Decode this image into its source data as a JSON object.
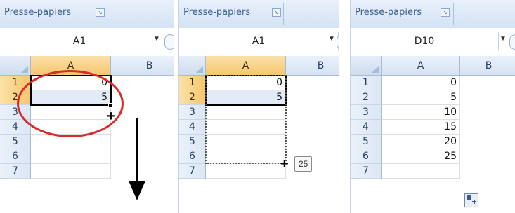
{
  "colors": {
    "accent_selected_header": "#f7c66e",
    "annotation_red": "#d92b2b"
  },
  "panels": [
    {
      "clipboard_label": "Presse-papiers",
      "namebox": "A1",
      "col_headers": [
        "A",
        "B"
      ],
      "row_headers": [
        "1",
        "2",
        "3",
        "4",
        "5",
        "6",
        "7"
      ],
      "cells": [
        "0",
        "5",
        "",
        "",
        "",
        "",
        ""
      ],
      "icons": [
        "dialog-launcher-icon",
        "chevron-down-icon",
        "fill-handle-crosshair-icon",
        "down-arrow-icon"
      ]
    },
    {
      "clipboard_label": "Presse-papiers",
      "namebox": "A1",
      "col_headers": [
        "A",
        "B"
      ],
      "row_headers": [
        "1",
        "2",
        "3",
        "4",
        "5",
        "6",
        "7"
      ],
      "cells": [
        "0",
        "5",
        "",
        "",
        "",
        "",
        ""
      ],
      "tooltip": "25",
      "icons": [
        "dialog-launcher-icon",
        "chevron-down-icon",
        "fill-handle-crosshair-icon"
      ]
    },
    {
      "clipboard_label": "Presse-papiers",
      "namebox": "D10",
      "col_headers": [
        "A",
        "B"
      ],
      "row_headers": [
        "1",
        "2",
        "3",
        "4",
        "5",
        "6",
        "7"
      ],
      "cells": [
        "0",
        "5",
        "10",
        "15",
        "20",
        "25",
        ""
      ],
      "icons": [
        "dialog-launcher-icon",
        "chevron-down-icon",
        "auto-fill-options-icon"
      ]
    }
  ]
}
